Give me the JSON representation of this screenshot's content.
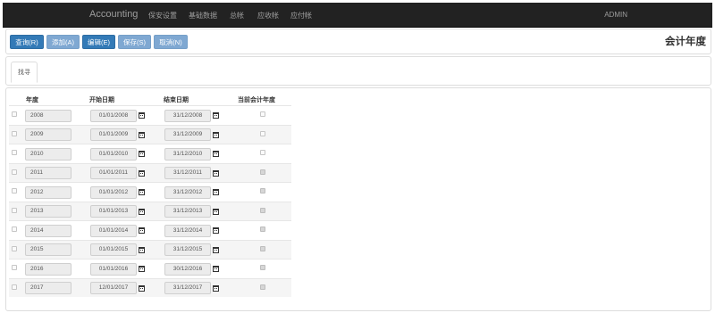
{
  "navbar": {
    "brand": "Accounting",
    "items": [
      "保安设置",
      "基础数据",
      "总帐",
      "应收帐",
      "应付帐"
    ],
    "user": "ADMIN"
  },
  "toolbar": {
    "query_label": "查询(R)",
    "add_label": "添加(A)",
    "edit_label": "编辑(E)",
    "save_label": "保存(S)",
    "cancel_label": "取消(N)",
    "page_title": "会计年度"
  },
  "tabs": {
    "search_label": "找寻"
  },
  "grid": {
    "columns": [
      "年度",
      "开始日期",
      "结束日期",
      "当前会计年度"
    ],
    "rows": [
      {
        "year": "2008",
        "start": "01/01/2008",
        "end": "31/12/2008",
        "current": false
      },
      {
        "year": "2009",
        "start": "01/01/2009",
        "end": "31/12/2009",
        "current": false
      },
      {
        "year": "2010",
        "start": "01/01/2010",
        "end": "31/12/2010",
        "current": false
      },
      {
        "year": "2011",
        "start": "01/01/2011",
        "end": "31/12/2011",
        "current": true
      },
      {
        "year": "2012",
        "start": "01/01/2012",
        "end": "31/12/2012",
        "current": true
      },
      {
        "year": "2013",
        "start": "01/01/2013",
        "end": "31/12/2013",
        "current": true
      },
      {
        "year": "2014",
        "start": "01/01/2014",
        "end": "31/12/2014",
        "current": true
      },
      {
        "year": "2015",
        "start": "01/01/2015",
        "end": "31/12/2015",
        "current": true
      },
      {
        "year": "2016",
        "start": "01/01/2016",
        "end": "30/12/2016",
        "current": true
      },
      {
        "year": "2017",
        "start": "12/01/2017",
        "end": "31/12/2017",
        "current": true
      }
    ]
  },
  "colors": {
    "navbar_bg": "#222222",
    "primary": "#337ab7",
    "primary_disabled": "#7fa8d2"
  },
  "icons": {
    "date_picker": "calendar-icon"
  }
}
